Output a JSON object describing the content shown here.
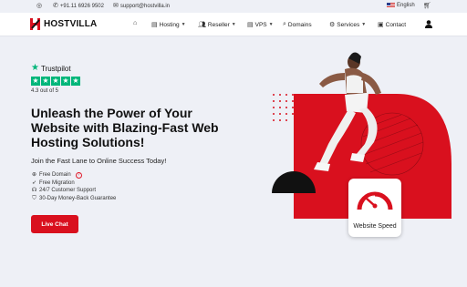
{
  "topbar": {
    "phone": "+91.11 6926 9502",
    "email": "support@hostvilla.in",
    "language": "English"
  },
  "brand": {
    "name": "HOSTVILLA",
    "color": "#d9101e"
  },
  "nav": {
    "hosting": "Hosting",
    "reseller": "Reseller",
    "vps": "VPS",
    "domains": "Domains",
    "services": "Services",
    "contact": "Contact"
  },
  "trustpilot": {
    "brand": "Trustpilot",
    "rating_text": "4.3 out of 5",
    "stars": 5
  },
  "hero": {
    "headline": "Unleash the Power of Your Website with Blazing-Fast Web Hosting Solutions!",
    "subheadline": "Join the Fast Lane to Online Success Today!",
    "features": [
      {
        "icon": "globe-icon",
        "text": "Free Domain"
      },
      {
        "icon": "rocket-icon",
        "text": "Free Migration"
      },
      {
        "icon": "headset-icon",
        "text": "24/7 Customer Support"
      },
      {
        "icon": "shield-icon",
        "text": "30-Day Money-Back Guarantee"
      }
    ],
    "cta_label": "Live Chat",
    "speed_badge": "Website Speed"
  },
  "colors": {
    "accent": "#d9101e",
    "trustpilot_green": "#00b67a",
    "background": "#eef0f6"
  }
}
